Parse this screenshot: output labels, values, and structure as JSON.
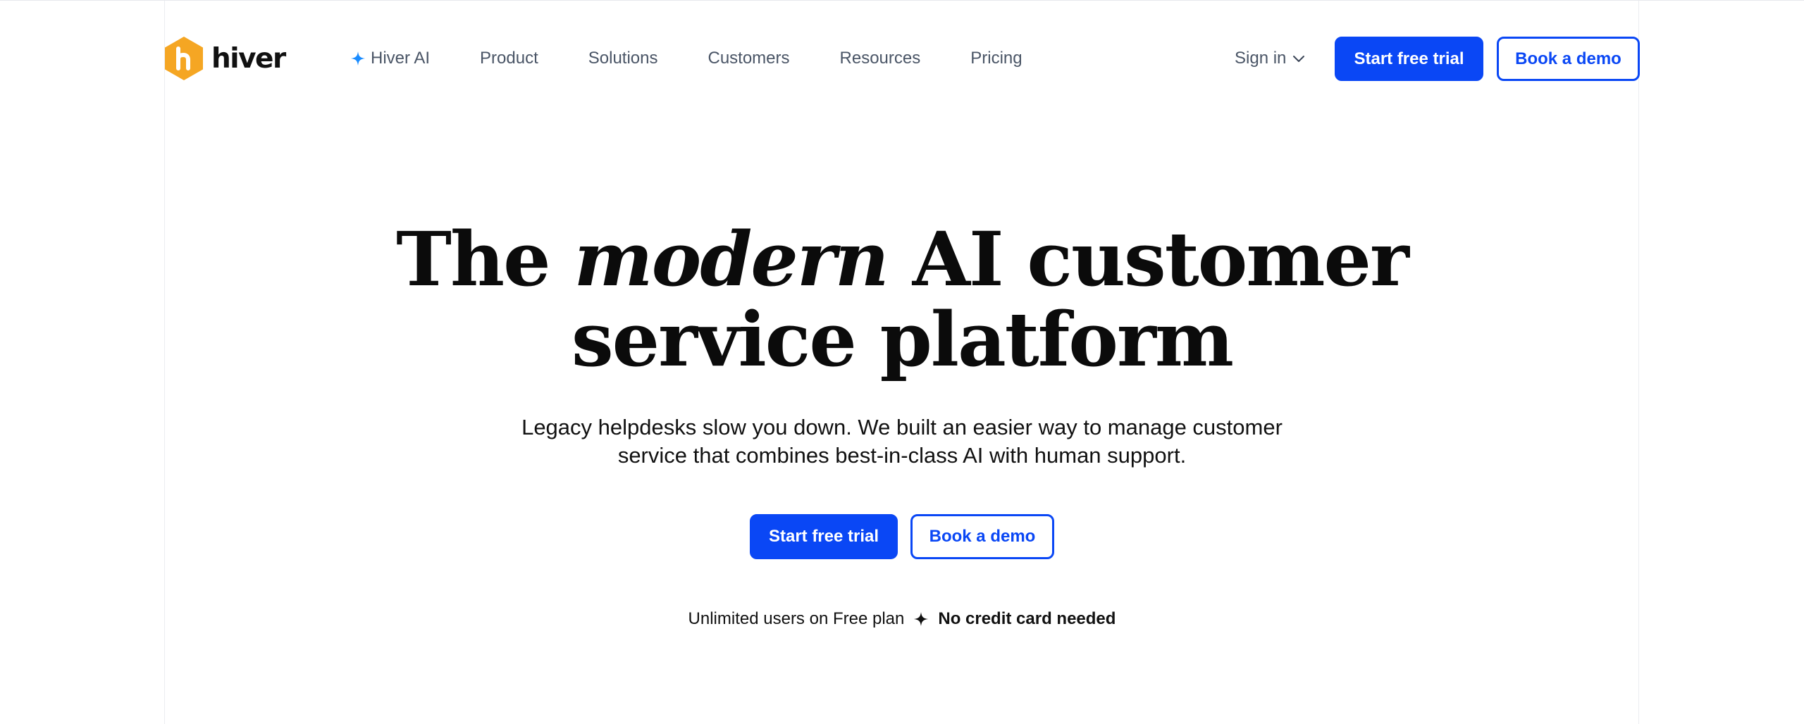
{
  "brand": {
    "name": "hiver",
    "logo_color": "#f5a623",
    "icon": "hiver-logo-icon"
  },
  "nav": {
    "links": [
      {
        "label": "Hiver AI",
        "icon": "sparkle-icon"
      },
      {
        "label": "Product"
      },
      {
        "label": "Solutions"
      },
      {
        "label": "Customers"
      },
      {
        "label": "Resources"
      },
      {
        "label": "Pricing"
      }
    ],
    "sign_in": {
      "label": "Sign in",
      "icon": "chevron-down-icon"
    },
    "start_trial_label": "Start free trial",
    "book_demo_label": "Book a demo"
  },
  "hero": {
    "title_word_1": "The",
    "title_emphasis": "modern",
    "title_rest_line1": "AI customer",
    "title_line2": "service platform",
    "subtitle_line1": "Legacy helpdesks slow you down. We built an easier way to manage customer",
    "subtitle_line2": "service that combines best-in-class AI with human support.",
    "start_trial_label": "Start free trial",
    "book_demo_label": "Book a demo",
    "note_plain": "Unlimited users on Free plan",
    "note_icon": "sparkle-icon",
    "note_strong": "No credit card needed"
  },
  "colors": {
    "accent": "#0a47f5",
    "nav_text": "#4a5566",
    "ai_sparkle": "#1a8cff"
  }
}
